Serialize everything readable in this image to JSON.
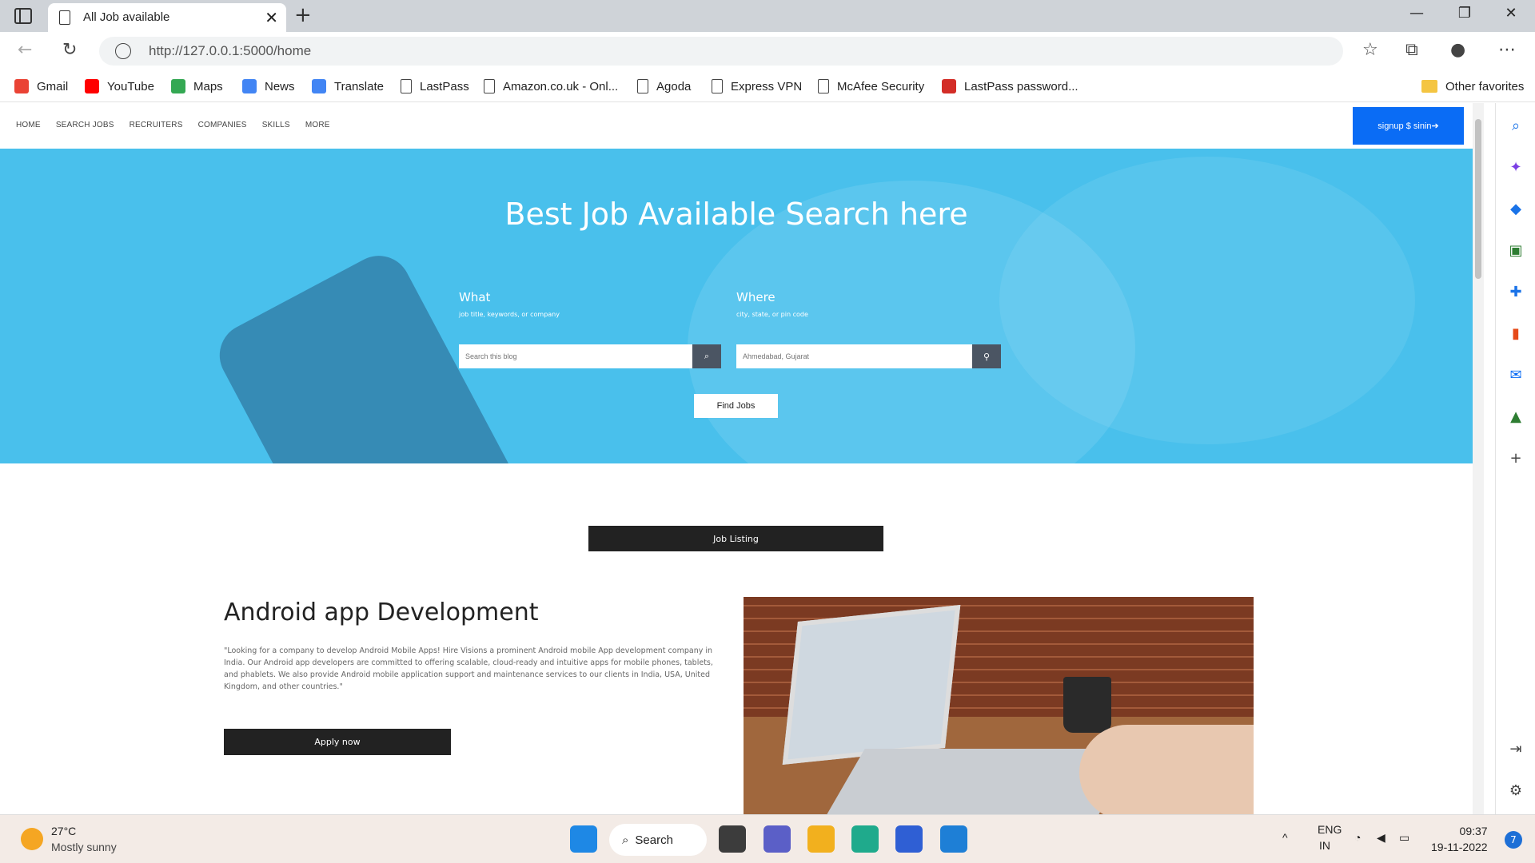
{
  "browser": {
    "tab_title": "All Job available",
    "url": "http://127.0.0.1:5000/home",
    "bookmarks": [
      {
        "label": "Gmail",
        "icon": "gmail-icon",
        "color": "#ea4335"
      },
      {
        "label": "YouTube",
        "icon": "youtube-icon",
        "color": "#ff0000"
      },
      {
        "label": "Maps",
        "icon": "maps-icon",
        "color": "#34a853"
      },
      {
        "label": "News",
        "icon": "news-icon",
        "color": "#4285f4"
      },
      {
        "label": "Translate",
        "icon": "translate-icon",
        "color": "#4285f4"
      },
      {
        "label": "LastPass",
        "icon": "page-icon",
        "color": "#ffffff"
      },
      {
        "label": "Amazon.co.uk - Onl...",
        "icon": "page-icon",
        "color": "#ffffff"
      },
      {
        "label": "Agoda",
        "icon": "page-icon",
        "color": "#ffffff"
      },
      {
        "label": "Express VPN",
        "icon": "page-icon",
        "color": "#ffffff"
      },
      {
        "label": "McAfee Security",
        "icon": "page-icon",
        "color": "#ffffff"
      },
      {
        "label": "LastPass password...",
        "icon": "lastpass-icon",
        "color": "#d32d27"
      }
    ],
    "other_favorites": "Other favorites"
  },
  "site": {
    "menu": [
      "HOME",
      "SEARCH JOBS",
      "RECRUITERS",
      "COMPANIES",
      "SKILLS",
      "MORE"
    ],
    "signup_label": "signup $ sinin➔",
    "accent_color": "#0a6cf5"
  },
  "hero": {
    "title": "Best Job Available Search here",
    "what_label": "What",
    "what_hint": "job title, keywords, or company",
    "what_placeholder": "Search this blog",
    "where_label": "Where",
    "where_hint": "city, state, or pin code",
    "where_placeholder": "Ahmedabad, Gujarat",
    "find_button": "Find Jobs",
    "background_color": "#49c0ec"
  },
  "listing": {
    "section_button": "Job Listing",
    "job_title": "Android app Development",
    "job_description": "\"Looking for a company to develop Android Mobile Apps! Hire Visions a prominent Android mobile App development company in India. Our Android app developers are committed to offering scalable, cloud-ready and intuitive apps for mobile phones, tablets, and phablets. We also provide Android mobile application support and maintenance services to our clients in India, USA, United Kingdom, and other countries.\"",
    "apply_button": "Apply now"
  },
  "taskbar": {
    "temperature": "27°C",
    "weather": "Mostly sunny",
    "search_label": "Search",
    "language": "ENG",
    "region": "IN",
    "time": "09:37",
    "date": "19-11-2022",
    "notifications": "7"
  }
}
